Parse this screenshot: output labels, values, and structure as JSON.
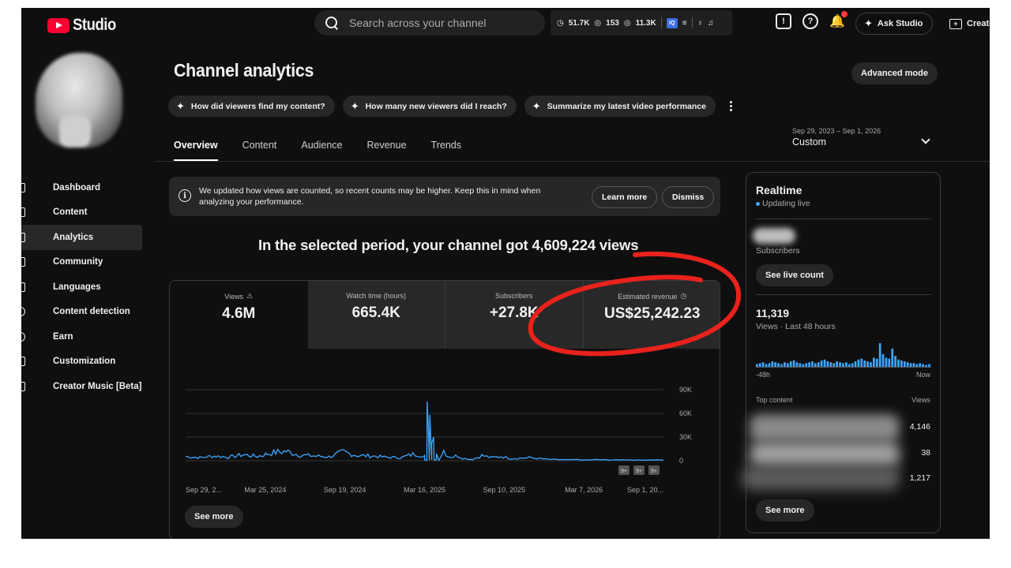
{
  "header": {
    "logo_text": "Studio",
    "search_placeholder": "Search across your channel",
    "ext_stats": [
      "51.7K",
      "153",
      "11.3K"
    ],
    "ask_label": "Ask Studio",
    "create_label": "Create"
  },
  "sidebar": {
    "items": [
      {
        "label": "Dashboard",
        "icon": "dashboard-icon"
      },
      {
        "label": "Content",
        "icon": "content-icon"
      },
      {
        "label": "Analytics",
        "icon": "analytics-icon",
        "active": true
      },
      {
        "label": "Community",
        "icon": "community-icon"
      },
      {
        "label": "Languages",
        "icon": "languages-icon"
      },
      {
        "label": "Content detection",
        "icon": "content-detection-icon"
      },
      {
        "label": "Earn",
        "icon": "earn-icon"
      },
      {
        "label": "Customization",
        "icon": "customization-icon"
      },
      {
        "label": "Creator Music [Beta]",
        "icon": "creator-music-icon"
      }
    ]
  },
  "main": {
    "title": "Channel analytics",
    "advanced_mode": "Advanced mode",
    "chips": [
      "How did viewers find my content?",
      "How many new viewers did I reach?",
      "Summarize my latest video performance"
    ],
    "tabs": [
      "Overview",
      "Content",
      "Audience",
      "Revenue",
      "Trends"
    ],
    "date_range": {
      "range": "Sep 29, 2023 – Sep 1, 2026",
      "label": "Custom"
    },
    "notice": {
      "text": "We updated how views are counted, so recent counts may be higher. Keep this in mind when analyzing your performance.",
      "learn_more": "Learn more",
      "dismiss": "Dismiss"
    },
    "headline": "In the selected period, your channel got 4,609,224 views",
    "metrics": [
      {
        "label": "Views",
        "value": "4.6M",
        "icon": "warning-icon"
      },
      {
        "label": "Watch time (hours)",
        "value": "665.4K"
      },
      {
        "label": "Subscribers",
        "value": "+27.8K"
      },
      {
        "label": "Estimated revenue",
        "value": "US$25,242.23",
        "icon": "clock-icon"
      }
    ],
    "see_more": "See more",
    "accent": "#3ea6ff"
  },
  "chart_data": {
    "type": "line",
    "x_tick_labels": [
      "Sep 29, 2...",
      "Mar 25, 2024",
      "Sep 19, 2024",
      "Mar 16, 2025",
      "Sep 10, 2025",
      "Mar 7, 2026",
      "Sep 1, 20..."
    ],
    "y_ticks": [
      0,
      30000,
      60000,
      90000
    ],
    "y_tick_labels": [
      "0",
      "30K",
      "60K",
      "90K"
    ],
    "ylim": [
      0,
      90000
    ],
    "grid": true,
    "badges": [
      "9+",
      "9+",
      "9+"
    ],
    "series": [
      {
        "x": [
          0,
          0.03,
          0.06,
          0.09,
          0.12,
          0.15,
          0.18,
          0.21,
          0.24,
          0.27,
          0.3,
          0.33,
          0.36,
          0.39,
          0.42,
          0.45,
          0.48,
          0.5,
          0.5,
          0.505,
          0.51,
          0.52,
          0.53,
          0.54,
          0.55,
          0.56,
          0.57,
          0.58,
          0.59,
          0.6,
          0.62,
          0.64,
          0.66,
          0.68,
          0.7,
          0.72,
          0.74,
          0.76,
          0.78,
          0.8,
          0.82,
          0.84,
          0.86,
          0.88,
          0.9,
          0.92,
          0.94,
          0.96,
          1.0
        ],
        "y": [
          5000,
          3500,
          5500,
          4000,
          7000,
          5000,
          9000,
          11000,
          6500,
          5500,
          4500,
          10000,
          6000,
          5500,
          4000,
          3500,
          8000,
          6000,
          1000,
          500,
          500,
          1000,
          800,
          12000,
          5000,
          4500,
          6000,
          3000,
          2000,
          1500,
          6000,
          3500,
          5000,
          2500,
          3000,
          3500,
          2500,
          1500,
          1200,
          1000,
          1200,
          800,
          1300,
          1000,
          900,
          1200,
          700,
          900,
          800
        ],
        "y_peak_index": 19
      }
    ]
  },
  "realtime": {
    "title": "Realtime",
    "status": "Updating live",
    "subscribers_label": "Subscribers",
    "live_count_btn": "See live count",
    "views": "11,319",
    "views_sub": "Views · Last 48 hours",
    "axis_start": "-48h",
    "axis_end": "Now",
    "top_content": "Top content",
    "views_col": "Views",
    "top_values": [
      "4,146",
      "38",
      "1,217"
    ],
    "see_more": "See more",
    "bars": [
      3,
      4,
      5,
      3,
      4,
      6,
      5,
      4,
      3,
      5,
      4,
      6,
      7,
      5,
      4,
      3,
      4,
      5,
      6,
      4,
      5,
      7,
      8,
      6,
      5,
      4,
      6,
      5,
      4,
      5,
      3,
      4,
      6,
      8,
      9,
      7,
      6,
      5,
      10,
      9,
      26,
      14,
      10,
      9,
      20,
      12,
      8,
      7,
      6,
      5,
      4,
      4,
      3,
      4,
      3,
      2,
      3
    ]
  },
  "annotation_color": "#e8221c"
}
